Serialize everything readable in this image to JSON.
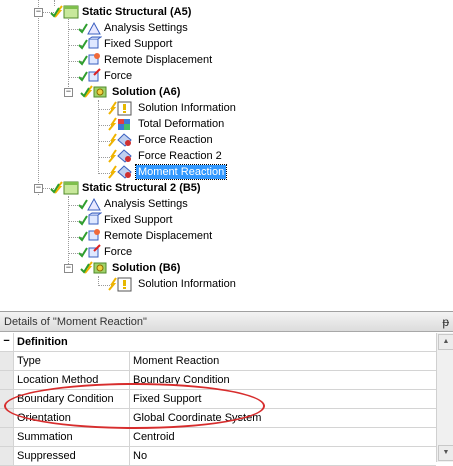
{
  "tree": {
    "static_structural_a5": "Static Structural (A5)",
    "a5_children": [
      "Analysis Settings",
      "Fixed Support",
      "Remote Displacement",
      "Force"
    ],
    "solution_a6": "Solution (A6)",
    "a6_children": [
      "Solution Information",
      "Total Deformation",
      "Force Reaction",
      "Force Reaction 2",
      "Moment Reaction"
    ],
    "static_structural_2_b5": "Static Structural 2 (B5)",
    "b5_children": [
      "Analysis Settings",
      "Fixed Support",
      "Remote Displacement",
      "Force"
    ],
    "solution_b6": "Solution (B6)",
    "b6_children": [
      "Solution Information"
    ],
    "expand_minus": "−",
    "selected_item": "Moment Reaction"
  },
  "details": {
    "header": "Details of \"Moment Reaction\"",
    "pin": "ᵽ",
    "group": "Definition",
    "group_toggle": "−",
    "rows": [
      {
        "key": "Type",
        "value": "Moment Reaction"
      },
      {
        "key": "Location Method",
        "value": "Boundary Condition"
      },
      {
        "key": "Boundary Condition",
        "value": "Fixed Support"
      },
      {
        "key": "Orientation",
        "value": "Global Coordinate System"
      },
      {
        "key": "Summation",
        "value": "Centroid"
      },
      {
        "key": "Suppressed",
        "value": "No"
      }
    ]
  },
  "colors": {
    "selection": "#3399ff",
    "annotation_ellipse": "#d72d2d",
    "check_green": "#2e9e2e",
    "lightning": "#f0b400"
  }
}
